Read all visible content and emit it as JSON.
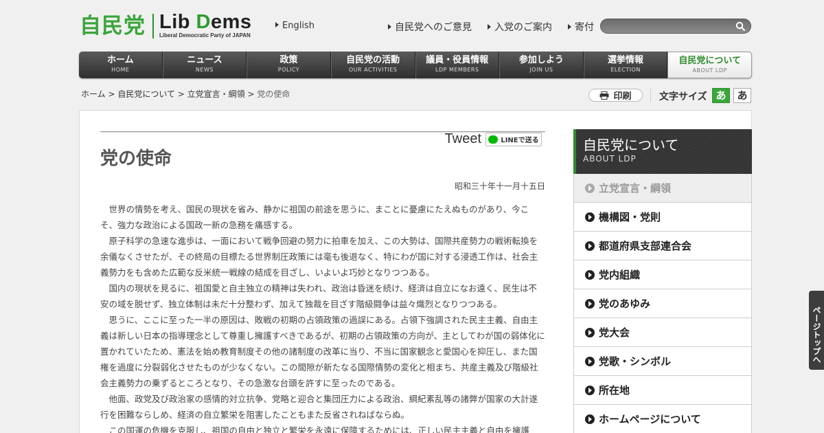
{
  "header": {
    "logo_jp": "自民党",
    "logo_en_lib": "Lib ",
    "logo_en_d": "D",
    "logo_en_ems": "ems",
    "logo_en_sub": "Liberal Democratic Party of JAPAN",
    "lang_link": "English",
    "top_links": [
      "自民党へのご意見",
      "入党のご案内",
      "寄付"
    ],
    "search": {
      "value": "",
      "placeholder": ""
    }
  },
  "gnav": [
    {
      "jp": "ホーム",
      "en": "HOME"
    },
    {
      "jp": "ニュース",
      "en": "NEWS"
    },
    {
      "jp": "政策",
      "en": "POLICY"
    },
    {
      "jp": "自民党の活動",
      "en": "OUR ACTIVITIES"
    },
    {
      "jp": "議員・役員情報",
      "en": "LDP MEMBERS"
    },
    {
      "jp": "参加しよう",
      "en": "JOIN US"
    },
    {
      "jp": "選挙情報",
      "en": "ELECTION"
    },
    {
      "jp": "自民党について",
      "en": "ABOUT LDP"
    }
  ],
  "breadcrumb": {
    "items": [
      "ホーム",
      "自民党について",
      "立党宣言・綱領"
    ],
    "separator": " > ",
    "current": "党の使命"
  },
  "tools": {
    "print": "印刷",
    "fontsize_label": "文字サイズ",
    "fs_small": "あ",
    "fs_large": "あ"
  },
  "share": {
    "tweet": "Tweet",
    "line": "LINEで送る"
  },
  "article": {
    "title": "党の使命",
    "date": "昭和三十年十一月十五日",
    "paragraphs": [
      "世界の情勢を考え、国民の現状を省み、静かに祖国の前途を思うに、まことに憂慮にたえぬものがあり、今こそ、強力な政治による国政一新の急務を痛感する。",
      "原子科学の急速な進歩は、一面において戦争回避の努力に拍車を加え、この大勢は、国際共産勢力の戦術転換を余儀なくさせたが、その終局の目標たる世界制圧政策には毫も後退なく、特にわが国に対する浸透工作は、社会主義勢力をも含めた広範な反米統一戦線の結成を目ざし、いよいよ巧妙となりつつある。",
      "国内の現状を見るに、祖国愛と自主独立の精神は失われ、政治は昏迷を続け、経済は自立になお遠く、民生は不安の域を脱せず、独立体制は未だ十分整わず、加えて独裁を目ざす階級闘争は益々熾烈となりつつある。",
      "思うに、ここに至った一半の原因は、敗戦の初期の占領政策の過誤にある。占領下強調された民主主義、自由主義は新しい日本の指導理念として尊重し擁護すべきであるが、初期の占領政策の方向が、主としてわが国の弱体化に置かれていたため、憲法を始め教育制度その他の諸制度の改革に当り、不当に国家観念と愛国心を抑圧し、また国権を過度に分裂弱化させたものが少なくない。この間隙が新たなる国際情勢の変化と相まち、共産主義及び階級社会主義勢力の乗ずるところとなり、その急激な台頭を許すに至ったのである。",
      "他面、政党及び政治家の感情的対立抗争、党略と迎合と集団圧力による政治、綱紀素乱等の諸弊が国家の大計遂行を困難ならしめ、経済の自立繁栄を阻害したこともまた反省されねばならぬ。",
      "この国運の危機を克服し、祖国の自由と独立と繁栄を永遠に保障するためには、正しい民主主義と自由を擁護し、真に"
    ]
  },
  "side": {
    "head_jp": "自民党について",
    "head_en": "ABOUT LDP",
    "items": [
      "立党宣言・綱領",
      "機構図・党則",
      "都道府県支部連合会",
      "党内組織",
      "党のあゆみ",
      "党大会",
      "党歌・シンボル",
      "所在地",
      "ホームページについて"
    ]
  },
  "pagetop": "ページトップへ"
}
